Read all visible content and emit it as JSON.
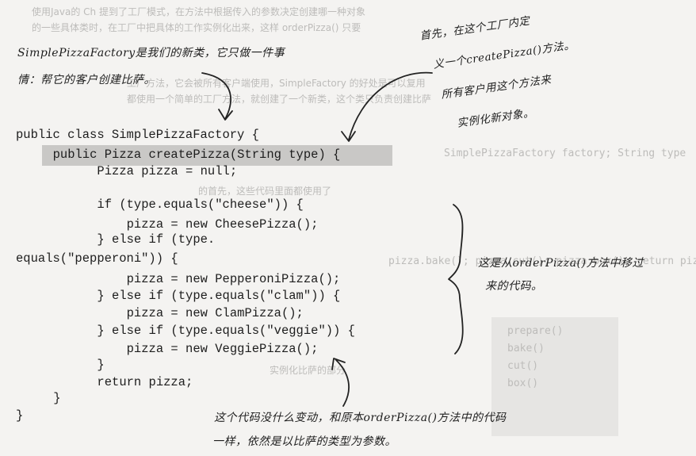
{
  "bleed_through": [
    "使用Java的 Ch 提到了工厂模式，在方法中根据传入的参数决定创建哪一种对象",
    "的一些具体类时，在工厂中把具体的工作实例化出来，这样 orderPizza() 只要",
    "工厂方法，它会被所有客户端使用，SimpleFactory 的好处是可以复用",
    "都使用一个简单的工厂方法，就创建了一个新类，这个类只负责创建比萨",
    "SimplePizzaFactory factory; String type",
    "pizza.bake(); pizza.cut(); pizza.box(); return pizza;",
    "的首先，这些代码里面都使用了",
    "实例化比萨的部分",
    "prepare()",
    "bake()",
    "cut()",
    "box()"
  ],
  "code": {
    "lines": [
      "public class SimplePizzaFactory {",
      "  public Pizza createPizza(String type) {",
      "        Pizza pizza = null;",
      "",
      "        if (type.equals(\"cheese\")) {",
      "            pizza = new CheesePizza();",
      "        } else if (type.",
      "equals(\"pepperoni\")) {",
      "            pizza = new PepperoniPizza();",
      "        } else if (type.equals(\"clam\")) {",
      "            pizza = new ClamPizza();",
      "        } else if (type.equals(\"veggie\")) {",
      "            pizza = new VeggiePizza();",
      "        }",
      "        return pizza;",
      "    }",
      "}"
    ]
  },
  "annotations": {
    "top_left_line1": "SimplePizzaFactory是我们的新类，它只做一件事",
    "top_left_line2": "情：帮它的客户创建比萨。",
    "top_right_line1": "首先，在这个工厂内定",
    "top_right_line2": "义一个createPizza()方法。",
    "top_right_line3": "所有客户用这个方法来",
    "top_right_line4": "实例化新对象。",
    "right_line1": "这是从orderPizza()方法中移过",
    "right_line2": "来的代码。",
    "bottom_line1": "这个代码没什么变动，和原本orderPizza()方法中的代码",
    "bottom_line2": "一样，依然是以比萨的类型为参数。"
  },
  "colors": {
    "background": "#f4f3f1",
    "highlight": "#c9c8c6",
    "ink": "#1e1e1e",
    "bleed": "#bdbcba"
  }
}
